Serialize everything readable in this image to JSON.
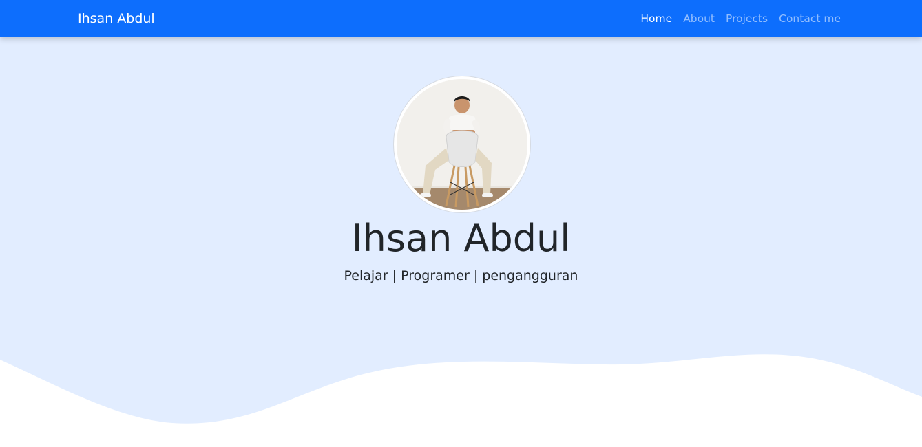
{
  "navbar": {
    "brand": "Ihsan Abdul",
    "links": [
      {
        "label": "Home",
        "active": true
      },
      {
        "label": "About",
        "active": false
      },
      {
        "label": "Projects",
        "active": false
      },
      {
        "label": "Contact me",
        "active": false
      }
    ]
  },
  "hero": {
    "name": "Ihsan Abdul",
    "tagline": "Pelajar | Programer | pengangguran",
    "avatar_icon": "profile-photo"
  },
  "colors": {
    "navbar_bg": "#0d6efd",
    "hero_bg": "#e2edff",
    "wave": "#ffffff",
    "text": "#212529"
  }
}
